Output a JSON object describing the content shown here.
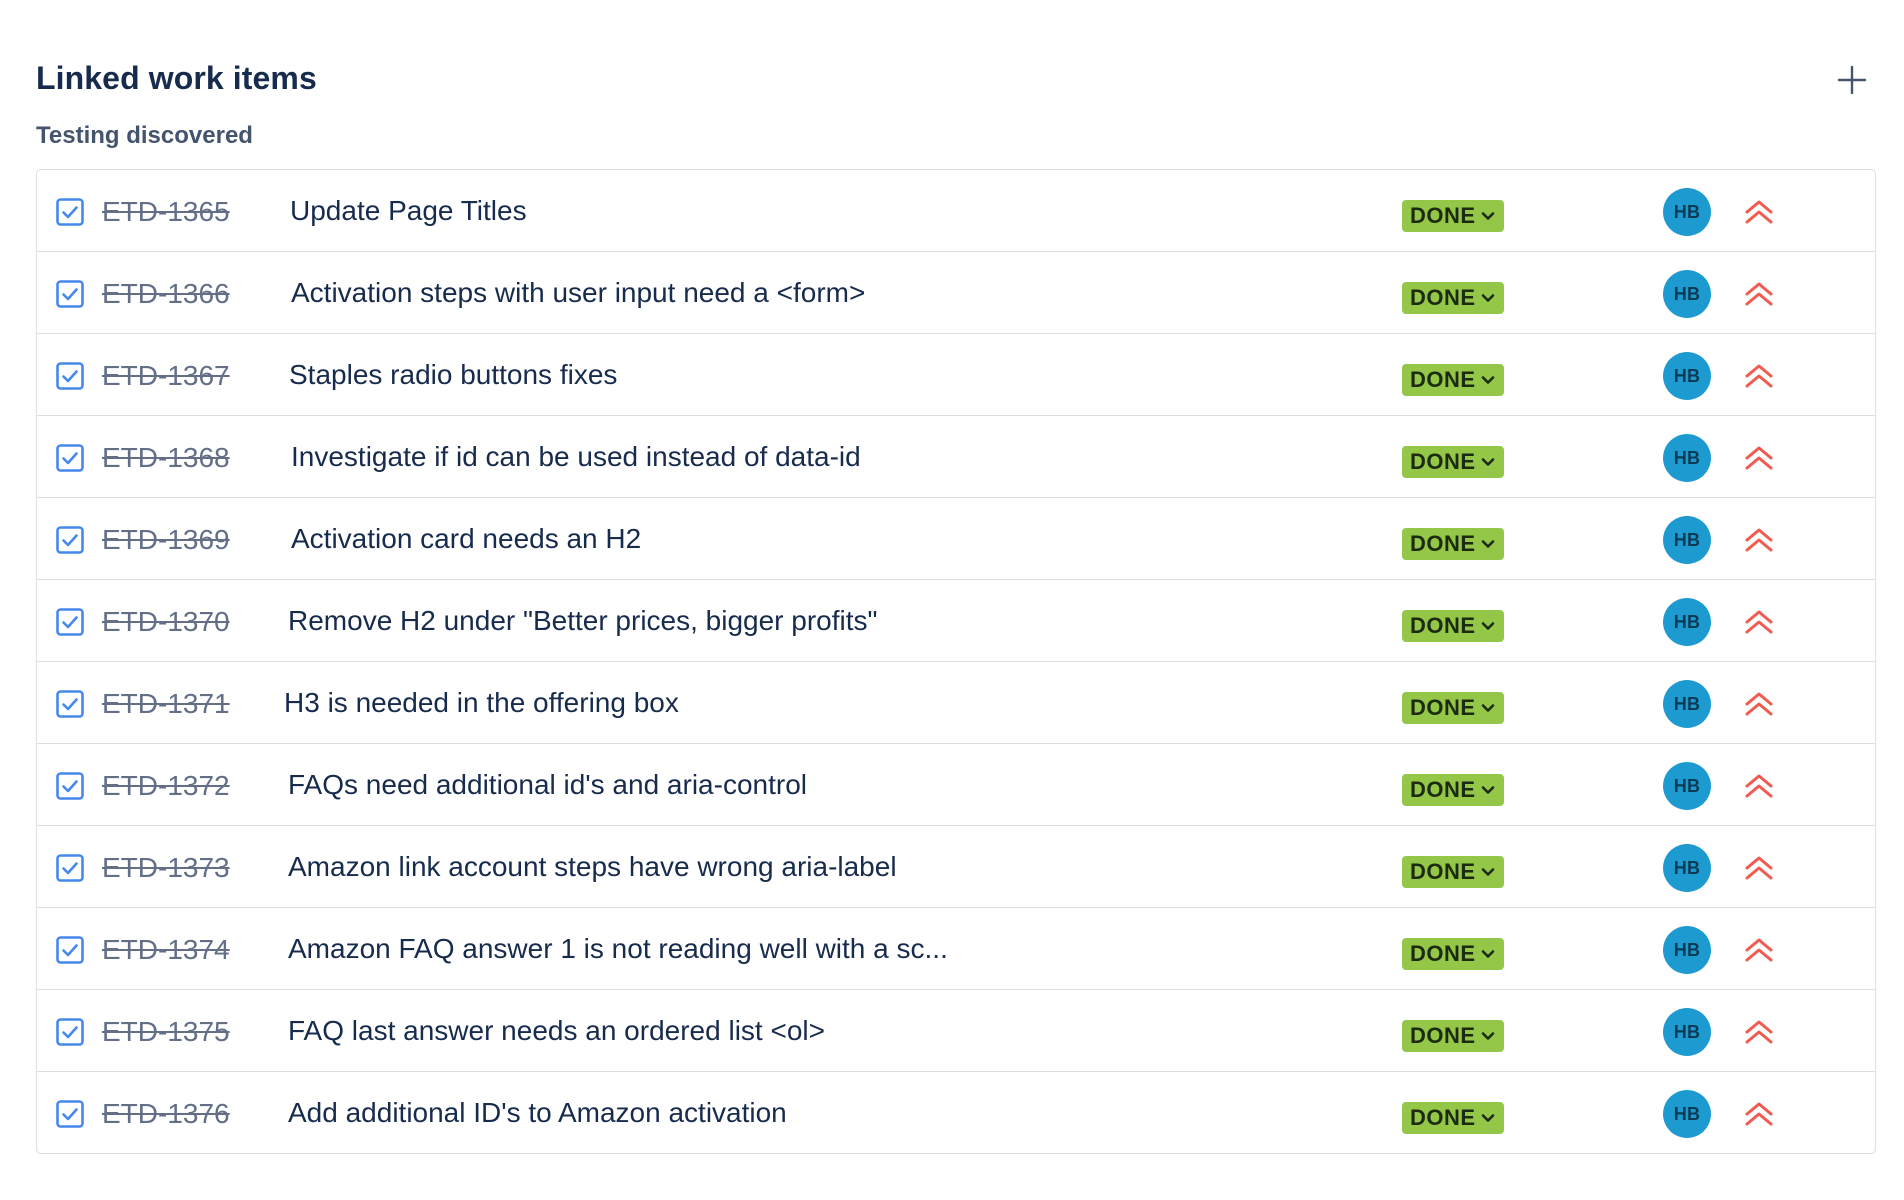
{
  "header": {
    "title": "Linked work items"
  },
  "group": {
    "label": "Testing discovered"
  },
  "items": [
    {
      "key": "ETD-1365",
      "summary": "Update Page Titles",
      "status": "DONE",
      "assignee": "HB"
    },
    {
      "key": "ETD-1366",
      "summary": "Activation steps with user input need a <form>",
      "status": "DONE",
      "assignee": "HB"
    },
    {
      "key": "ETD-1367",
      "summary": "Staples radio buttons fixes",
      "status": "DONE",
      "assignee": "HB"
    },
    {
      "key": "ETD-1368",
      "summary": "Investigate if id can be used instead of data-id",
      "status": "DONE",
      "assignee": "HB"
    },
    {
      "key": "ETD-1369",
      "summary": "Activation card needs an H2",
      "status": "DONE",
      "assignee": "HB"
    },
    {
      "key": "ETD-1370",
      "summary": "Remove H2 under \"Better prices, bigger profits\"",
      "status": "DONE",
      "assignee": "HB"
    },
    {
      "key": "ETD-1371",
      "summary": "H3 is needed in the offering box",
      "status": "DONE",
      "assignee": "HB"
    },
    {
      "key": "ETD-1372",
      "summary": "FAQs need additional id's and aria-control",
      "status": "DONE",
      "assignee": "HB"
    },
    {
      "key": "ETD-1373",
      "summary": "Amazon link account steps have wrong aria-label",
      "status": "DONE",
      "assignee": "HB"
    },
    {
      "key": "ETD-1374",
      "summary": "Amazon FAQ answer 1 is not reading well with a sc...",
      "status": "DONE",
      "assignee": "HB"
    },
    {
      "key": "ETD-1375",
      "summary": "FAQ last answer needs an ordered list <ol>",
      "status": "DONE",
      "assignee": "HB"
    },
    {
      "key": "ETD-1376",
      "summary": "Add additional ID's to Amazon activation",
      "status": "DONE",
      "assignee": "HB"
    }
  ],
  "icons": {
    "type": "checkbox-task-icon",
    "priority": "highest-priority-icon",
    "add": "plus-icon",
    "status_chevron": "chevron-down-icon"
  },
  "colors": {
    "status_done_bg": "#94c748",
    "avatar_bg": "#1d9bd1",
    "priority": "#f15b50",
    "task_icon": "#4688ec"
  }
}
